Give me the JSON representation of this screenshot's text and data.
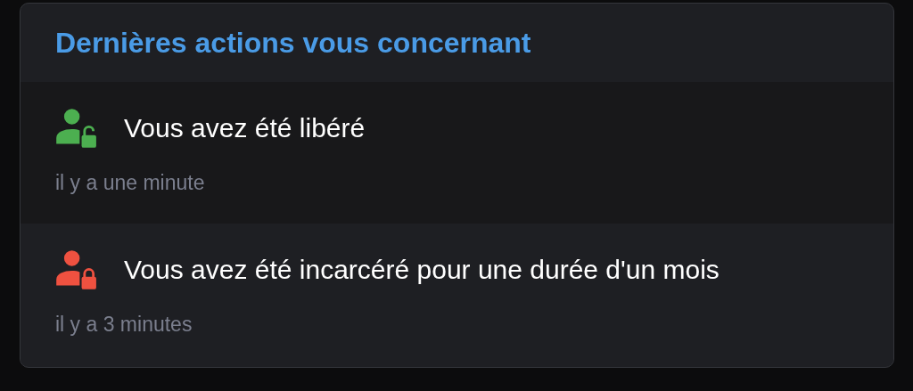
{
  "card": {
    "title": "Dernières actions vous concernant"
  },
  "actions": [
    {
      "kind": "unlocked",
      "message": "Vous avez été libéré",
      "time": "il y a une minute"
    },
    {
      "kind": "locked",
      "message": "Vous avez été incarcéré pour une durée d'un mois",
      "time": "il y a 3 minutes"
    }
  ]
}
